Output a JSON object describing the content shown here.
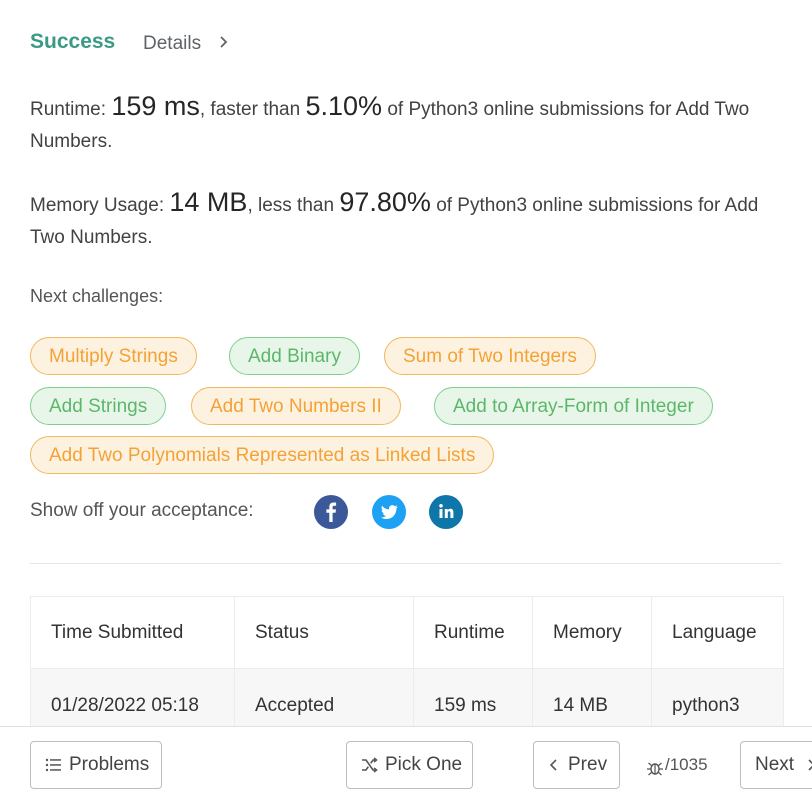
{
  "header": {
    "success": "Success",
    "details": "Details"
  },
  "runtime": {
    "label": "Runtime:",
    "value": "159 ms",
    "mid": ", faster than",
    "percent": "5.10%",
    "tail": "of Python3 online submissions for Add Two Numbers."
  },
  "memory": {
    "label": "Memory Usage:",
    "value": "14 MB",
    "mid": ", less than",
    "percent": "97.80%",
    "tail": "of Python3 online submissions for Add Two Numbers."
  },
  "next_challenges": {
    "label": "Next challenges:",
    "items": [
      {
        "label": "Multiply Strings",
        "difficulty_color": "orange"
      },
      {
        "label": "Add Binary",
        "difficulty_color": "green"
      },
      {
        "label": "Sum of Two Integers",
        "difficulty_color": "orange"
      },
      {
        "label": "Add Strings",
        "difficulty_color": "green"
      },
      {
        "label": "Add Two Numbers II",
        "difficulty_color": "orange"
      },
      {
        "label": "Add to Array-Form of Integer",
        "difficulty_color": "green"
      },
      {
        "label": "Add Two Polynomials Represented as Linked Lists",
        "difficulty_color": "orange"
      }
    ]
  },
  "share": {
    "label": "Show off your acceptance:",
    "icons": [
      "facebook-icon",
      "twitter-icon",
      "linkedin-icon"
    ],
    "colors": {
      "facebook": "#3b5998",
      "twitter": "#1da1f2",
      "linkedin": "#0e76a8"
    }
  },
  "table": {
    "headers": [
      "Time Submitted",
      "Status",
      "Runtime",
      "Memory",
      "Language"
    ],
    "rows": [
      [
        "01/28/2022 05:18",
        "Accepted",
        "159 ms",
        "14 MB",
        "python3"
      ]
    ]
  },
  "bottom": {
    "problems": "Problems",
    "pick_one": "Pick One",
    "prev": "Prev",
    "counter": "/1035",
    "next": "Next"
  },
  "colors": {
    "success": "#3a9a85",
    "orange_tag": "#f4a236",
    "green_tag": "#5cb769"
  }
}
